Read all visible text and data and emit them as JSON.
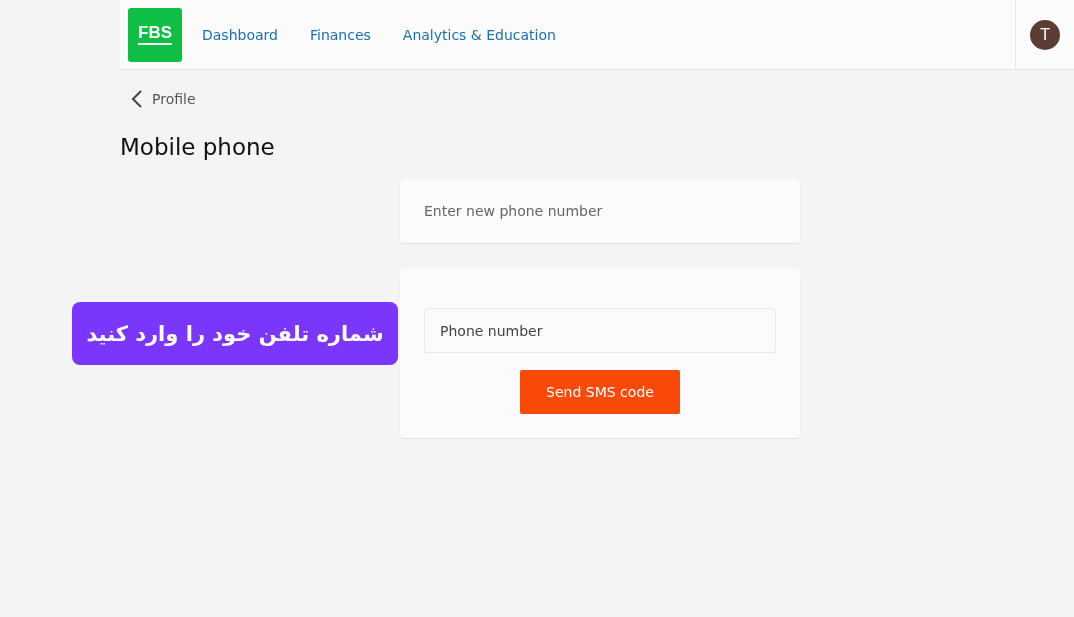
{
  "header": {
    "logo": "FBS",
    "nav": [
      {
        "label": "Dashboard"
      },
      {
        "label": "Finances"
      },
      {
        "label": "Analytics & Education"
      }
    ],
    "avatar": "T"
  },
  "breadcrumb": {
    "label": "Profile"
  },
  "title": "Mobile phone",
  "prompt_card": {
    "text": "Enter new phone number"
  },
  "form_card": {
    "field": {
      "placeholder": "Phone number"
    },
    "button": "Send SMS code"
  },
  "callout": {
    "text": "شماره تلفن خود را وارد کنید"
  }
}
